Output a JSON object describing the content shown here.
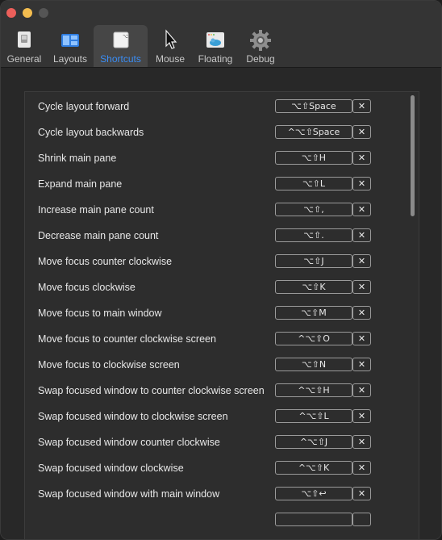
{
  "tabs": [
    {
      "label": "General",
      "icon": "general-icon"
    },
    {
      "label": "Layouts",
      "icon": "layouts-icon"
    },
    {
      "label": "Shortcuts",
      "icon": "shortcuts-icon"
    },
    {
      "label": "Mouse",
      "icon": "mouse-cursor-icon"
    },
    {
      "label": "Floating",
      "icon": "floating-icon"
    },
    {
      "label": "Debug",
      "icon": "gear-icon"
    }
  ],
  "active_tab": "Shortcuts",
  "clear_glyph": "✕",
  "shortcuts": [
    {
      "label": "Cycle layout forward",
      "keys": "⌥⇧Space"
    },
    {
      "label": "Cycle layout backwards",
      "keys": "^⌥⇧Space"
    },
    {
      "label": "Shrink main pane",
      "keys": "⌥⇧H"
    },
    {
      "label": "Expand main pane",
      "keys": "⌥⇧L"
    },
    {
      "label": "Increase main pane count",
      "keys": "⌥⇧,"
    },
    {
      "label": "Decrease main pane count",
      "keys": "⌥⇧."
    },
    {
      "label": "Move focus counter clockwise",
      "keys": "⌥⇧J"
    },
    {
      "label": "Move focus clockwise",
      "keys": "⌥⇧K"
    },
    {
      "label": "Move focus to main window",
      "keys": "⌥⇧M"
    },
    {
      "label": "Move focus to counter clockwise screen",
      "keys": "^⌥⇧O"
    },
    {
      "label": "Move focus to clockwise screen",
      "keys": "⌥⇧N"
    },
    {
      "label": "Swap focused window to counter clockwise screen",
      "keys": "^⌥⇧H"
    },
    {
      "label": "Swap focused window to clockwise screen",
      "keys": "^⌥⇧L"
    },
    {
      "label": "Swap focused window counter clockwise",
      "keys": "^⌥⇧J"
    },
    {
      "label": "Swap focused window clockwise",
      "keys": "^⌥⇧K"
    },
    {
      "label": "Swap focused window with main window",
      "keys": "⌥⇧↩"
    }
  ],
  "colors": {
    "accent": "#3a8df5",
    "close": "#ec5f5a",
    "minimize": "#f4bd4f"
  }
}
